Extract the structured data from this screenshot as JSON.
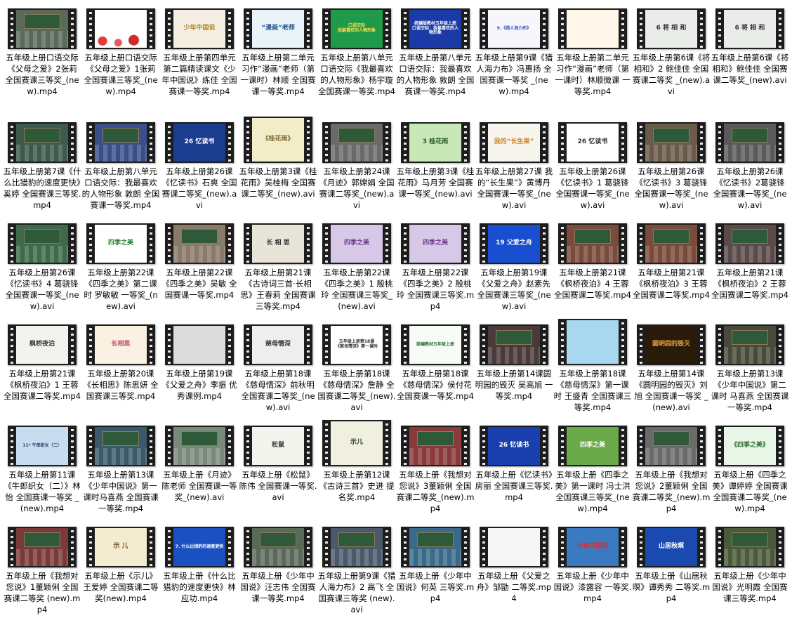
{
  "window_title": "",
  "files": [
    {
      "label": "五年级上册口语交际《父母之爱》2张莉 全国赛课三等奖_(new).mp4",
      "thumb": {
        "kind": "room",
        "bg": "#5a6a5a"
      }
    },
    {
      "label": "五年级上册口语交际《父母之爱》1张莉 全国赛课三等奖_(new).mp4",
      "thumb": {
        "kind": "hearts",
        "bg": "#ffffff",
        "text": ""
      }
    },
    {
      "label": "五年级上册第四单元第二篇精读课文《少年中国说》练佳 全国赛课一等奖.mp4",
      "thumb": {
        "kind": "title",
        "bg": "#f4efe2",
        "fg": "#b08a2a",
        "text": "少年中国说"
      }
    },
    {
      "label": "五年级上册第二单元习作“漫画”老师（第一课时）林顺 全国赛课一等奖.mp4",
      "thumb": {
        "kind": "title",
        "bg": "#eaf3f7",
        "fg": "#1e4f8a",
        "text": "“漫画”老师"
      }
    },
    {
      "label": "五年级上册第八单元口语交际《我最喜欢的人物形象》杨宇璇 全国赛课一等奖.mp4",
      "thumb": {
        "kind": "title",
        "bg": "#1f9a4a",
        "fg": "#ffe04a",
        "text": "口语交际\n我最喜欢的人物形象"
      }
    },
    {
      "label": "五年级上册第八单元 口语交际：我最喜欢的人物形象 敦朗 全国赛课一等奖.mp4",
      "thumb": {
        "kind": "title",
        "bg": "#1b3aa8",
        "fg": "#ffffff",
        "text": "统编版教材五年级上册\n口语交际：我最喜欢的人物形象"
      }
    },
    {
      "label": "五年级上册第9课《猎人海力布》冯惠扬 全国赛课一等奖 _(new).mp4",
      "thumb": {
        "kind": "title",
        "bg": "#f6f6fb",
        "fg": "#2d57c2",
        "text": "9.《猎人海力布》"
      }
    },
    {
      "label": "五年级上册第二单元习作“漫画”老师（第一课时）林顺微课 一等奖.mp4",
      "thumb": {
        "kind": "title",
        "bg": "#fff8ea",
        "fg": "#e06a2a",
        "text": ""
      }
    },
    {
      "label": "五年级上册第6课《将相和》2 鲍佳佳 全国赛课二等奖 _(new).avi",
      "thumb": {
        "kind": "title",
        "bg": "#e9ece9",
        "fg": "#333333",
        "text": "6 将 相 和"
      }
    },
    {
      "label": "五年级上册第6课《将相和》鲍佳佳 全国赛课二等奖_(new).avi",
      "thumb": {
        "kind": "title",
        "bg": "#e9ece9",
        "fg": "#333333",
        "text": "6 将 相 和"
      }
    },
    {
      "label": "五年级上册第7课《什么比猎豹的速度更快》奚婷 全国赛课三等奖.mp4",
      "thumb": {
        "kind": "room",
        "bg": "#3d5a4a"
      }
    },
    {
      "label": "五年级上册第八单元 口语交际：我最喜欢的人物形象 敦朗 全国赛课一等奖.mp4",
      "thumb": {
        "kind": "room",
        "bg": "#3a4f8a"
      }
    },
    {
      "label": "五年级上册第26课《忆读书》石爽 全国赛课二等奖_(new).avi",
      "thumb": {
        "kind": "title",
        "bg": "#1a3d8f",
        "fg": "#ffffff",
        "text": "26 忆读书"
      }
    },
    {
      "label": "五年级上册第3课《桂花雨》吴桂梅 全国赛课二等奖_(new).avi",
      "thumb": {
        "kind": "title",
        "bg": "#f2ecc8",
        "fg": "#7a6a2a",
        "text": "《桂花雨》",
        "tall": true
      }
    },
    {
      "label": "五年级上册第24课《月迹》郭嫦娟 全国赛课二等奖_(new).avi",
      "thumb": {
        "kind": "room",
        "bg": "#6a6a6a"
      }
    },
    {
      "label": "五年级上册第3课《桂花雨》马月芳 全国赛课一等奖_(new).avi",
      "thumb": {
        "kind": "title",
        "bg": "#c8e8b8",
        "fg": "#2a5a2a",
        "text": "3 桂花雨"
      }
    },
    {
      "label": "五年级上册第27课 我的“长生果”》黄博丹 全国赛课一等奖_(new).avi",
      "thumb": {
        "kind": "title",
        "bg": "#f6f6ee",
        "fg": "#d0822a",
        "text": "我的“长生果”"
      }
    },
    {
      "label": "五年级上册第26课《忆读书》1 葛骁锋 全国赛课一等奖_(new).avi",
      "thumb": {
        "kind": "title",
        "bg": "#ffffff",
        "fg": "#333333",
        "text": "26 忆读书"
      }
    },
    {
      "label": "五年级上册第26课《忆读书》3 葛骁锋 全国赛课一等奖_(new).avi",
      "thumb": {
        "kind": "room",
        "bg": "#6a5a4a"
      }
    },
    {
      "label": "五年级上册第26课《忆读书》2葛骁锋 全国赛课一等奖_(new).avi",
      "thumb": {
        "kind": "room",
        "bg": "#5a5a5a"
      }
    },
    {
      "label": "五年级上册第26课《忆读书》4 葛骁锋 全国赛课一等奖_(new).avi",
      "thumb": {
        "kind": "room",
        "bg": "#3f6a4a"
      }
    },
    {
      "label": "五年级上册第22课《四季之美》第二课时 罗敏敏 一等奖_(new).avi",
      "thumb": {
        "kind": "title",
        "bg": "#ffffff",
        "fg": "#2a7a2a",
        "text": "四季之美"
      }
    },
    {
      "label": "五年级上册第22课《四季之美》吴敏 全国赛课一等奖.mp4",
      "thumb": {
        "kind": "room",
        "bg": "#8a7a6a"
      }
    },
    {
      "label": "五年级上册第21课《古诗词三首·长相思》王春莉 全国赛课三等奖.mp4",
      "thumb": {
        "kind": "title",
        "bg": "#e8e4d8",
        "fg": "#333333",
        "text": "长 相 思"
      }
    },
    {
      "label": "五年级上册第22课《四季之美》1 殷桃玲 全国赛课三等奖_(new).avi",
      "thumb": {
        "kind": "title",
        "bg": "#d8c8e8",
        "fg": "#6a3a8a",
        "text": "四季之美"
      }
    },
    {
      "label": "五年级上册第22课《四季之美》2 殷桃玲 全国赛课三等奖.mp4",
      "thumb": {
        "kind": "title",
        "bg": "#d8c8e8",
        "fg": "#6a3a8a",
        "text": "四季之美"
      }
    },
    {
      "label": "五年级上册第19课《父爱之舟》赵素先 全国赛课三等奖_(new).avi",
      "thumb": {
        "kind": "title",
        "bg": "#1a4ed0",
        "fg": "#ffffff",
        "text": "19 父爱之舟"
      }
    },
    {
      "label": "五年级上册第21课《枫桥夜泊》4 王蓉 全国赛课二等奖.mp4",
      "thumb": {
        "kind": "room",
        "bg": "#7a4a3a"
      }
    },
    {
      "label": "五年级上册第21课《枫桥夜泊》3 王蓉 全国赛课二等奖.mp4",
      "thumb": {
        "kind": "room",
        "bg": "#7a4a3a"
      }
    },
    {
      "label": "五年级上册第21课《枫桥夜泊》2 王蓉 全国赛课二等奖.mp4",
      "thumb": {
        "kind": "room",
        "bg": "#5a4a4a"
      }
    },
    {
      "label": "五年级上册第21课《枫桥夜泊》1 王蓉 全国赛课二等奖.mp4",
      "thumb": {
        "kind": "title",
        "bg": "#f2f2ee",
        "fg": "#333333",
        "text": "枫桥夜泊"
      }
    },
    {
      "label": "五年级上册第20课《长相思》陈思妍 全国赛课三等奖.mp4",
      "thumb": {
        "kind": "title",
        "bg": "#fbf1e2",
        "fg": "#c04a6a",
        "text": "长相思"
      }
    },
    {
      "label": "五年级上册第19课《父爱之舟》李振 优秀课例.mp4",
      "thumb": {
        "kind": "title",
        "bg": "#dcdcdc",
        "fg": "#333333",
        "text": ""
      }
    },
    {
      "label": "五年级上册第18课《慈母情深》前秋明 全国赛课二等奖_(new).avi",
      "thumb": {
        "kind": "title",
        "bg": "#eeeeee",
        "fg": "#333333",
        "text": "慈母情深"
      }
    },
    {
      "label": "五年级上册第18课《慈母情深》詹静 全国赛课二等奖_(new).avi",
      "thumb": {
        "kind": "title",
        "bg": "#ffffff",
        "fg": "#333333",
        "text": "五年级上册第18课\n《慈母情深》第一课时"
      }
    },
    {
      "label": "五年级上册第18课《慈母情深》侯付花 全国赛课一等奖.mp4",
      "thumb": {
        "kind": "title",
        "bg": "#f6fbf6",
        "fg": "#2a6a3a",
        "text": "部编教材五年级上册"
      }
    },
    {
      "label": "五年级上册第14课圆明园的毁灭 吴高旭 一等奖.mp4",
      "thumb": {
        "kind": "room",
        "bg": "#4a3a3a"
      }
    },
    {
      "label": "五年级上册第18课《慈母情深》第一课时 王盛青 全国赛课三等奖.mp4",
      "thumb": {
        "kind": "title",
        "bg": "#a8d8f0",
        "fg": "#f0a01a",
        "text": "",
        "tall": true
      }
    },
    {
      "label": "五年级上册第14课《圆明园的毁灭》刘旭 全国赛课一等奖 _(new).avi",
      "thumb": {
        "kind": "title",
        "bg": "#2a1a0a",
        "fg": "#e0a040",
        "text": "圆明园的毁灭"
      }
    },
    {
      "label": "五年级上册第13课《少年中国说》第二课时 马喜燕 全国赛课一等奖.mp4",
      "thumb": {
        "kind": "room",
        "bg": "#4a4a3a"
      }
    },
    {
      "label": "五年级上册第11课《牛郎织女（二）》林怡 全国赛课一等奖 _(new).mp4",
      "thumb": {
        "kind": "title",
        "bg": "#c8dcf0",
        "fg": "#2a3a6a",
        "text": "11* 牛郎织女（二）"
      }
    },
    {
      "label": "五年级上册第13课《少年中国说》第一课时马喜燕 全国赛课一等奖.mp4",
      "thumb": {
        "kind": "room",
        "bg": "#3a5a6a"
      }
    },
    {
      "label": "五年级上册《月迹》陈老师 全国赛课一等奖_(new).avi",
      "thumb": {
        "kind": "room",
        "bg": "#7a8a7a"
      }
    },
    {
      "label": "五年级上册《松鼠》陈伟 全国赛课一等奖.avi",
      "thumb": {
        "kind": "title",
        "bg": "#f4f4ee",
        "fg": "#333333",
        "text": "松鼠"
      }
    },
    {
      "label": "五年级上册第12课《古诗三首》史进 提名奖.mp4",
      "thumb": {
        "kind": "title",
        "bg": "#f0f0e0",
        "fg": "#333333",
        "text": "示儿",
        "tall": true
      }
    },
    {
      "label": "五年级上册《我想对您说》3董颖俐 全国赛课二等奖_(new).mp4",
      "thumb": {
        "kind": "room",
        "bg": "#8a3a3a"
      }
    },
    {
      "label": "五年级上册《忆读书》房丽 全国赛课三等奖.mp4",
      "thumb": {
        "kind": "title",
        "bg": "#1a40b0",
        "fg": "#ffffff",
        "text": "26 忆读书"
      }
    },
    {
      "label": "五年级上册《四季之美》第一课时 冯士洪 全国赛课三等奖_(new).mp4",
      "thumb": {
        "kind": "title",
        "bg": "#6aaa4a",
        "fg": "#ffffff",
        "text": "四季之美"
      }
    },
    {
      "label": "五年级上册《我想对您说》2董颖俐 全国赛课二等奖_(new).mp4",
      "thumb": {
        "kind": "room",
        "bg": "#6a6a6a"
      }
    },
    {
      "label": "五年级上册《四季之美》谭婷婷 全国赛课全国赛课二等奖_(new).mp4",
      "thumb": {
        "kind": "title",
        "bg": "#e8f6e8",
        "fg": "#2a6a2a",
        "text": "《四季之美》"
      }
    },
    {
      "label": "五年级上册《我想对您说》1董颖俐 全国赛课二等奖 (new).mp4",
      "thumb": {
        "kind": "room",
        "bg": "#7a3a3a"
      }
    },
    {
      "label": "五年级上册《示儿》王爱婷 全国赛课二等奖(new).mp4",
      "thumb": {
        "kind": "title",
        "bg": "#f4ecd0",
        "fg": "#6a4a1a",
        "text": "示 儿"
      }
    },
    {
      "label": "五年级上册《什么比猎豹的速度更快》林应功.mp4",
      "thumb": {
        "kind": "title",
        "bg": "#1a50c0",
        "fg": "#ffffff",
        "text": "7. 什么比猎豹的速度更快"
      }
    },
    {
      "label": "五年级上册《少年中国说》汪志伟 全国赛课一等奖.mp4",
      "thumb": {
        "kind": "room",
        "bg": "#5a6a5a"
      }
    },
    {
      "label": "五年级上册第9课《猎人海力布》2 高飞 全国赛课三等奖 (new).avi",
      "thumb": {
        "kind": "room",
        "bg": "#4a5a6a"
      }
    },
    {
      "label": "五年级上册《少年中国说》何英 三等奖.mp4",
      "thumb": {
        "kind": "room",
        "bg": "#3a6a8a"
      }
    },
    {
      "label": "五年级上册《父爱之舟》邹勖 二等奖.mp4",
      "thumb": {
        "kind": "title",
        "bg": "#f6f6f6",
        "fg": "#555555",
        "text": ""
      }
    },
    {
      "label": "五年级上册《少年中国说》漆露容 一等奖.mp4",
      "thumb": {
        "kind": "title",
        "bg": "#3a7ac0",
        "fg": "#e02a2a",
        "text": "少年中国说"
      }
    },
    {
      "label": "五年级上册《山居秋暝》谭秀秀 二等奖.mp4",
      "thumb": {
        "kind": "title",
        "bg": "#1a4ab0",
        "fg": "#ffffff",
        "text": "山居秋暝"
      }
    },
    {
      "label": "五年级上册《少年中国说》光明霞 全国赛课三等奖.mp4",
      "thumb": {
        "kind": "room",
        "bg": "#4a5a3a"
      }
    }
  ]
}
